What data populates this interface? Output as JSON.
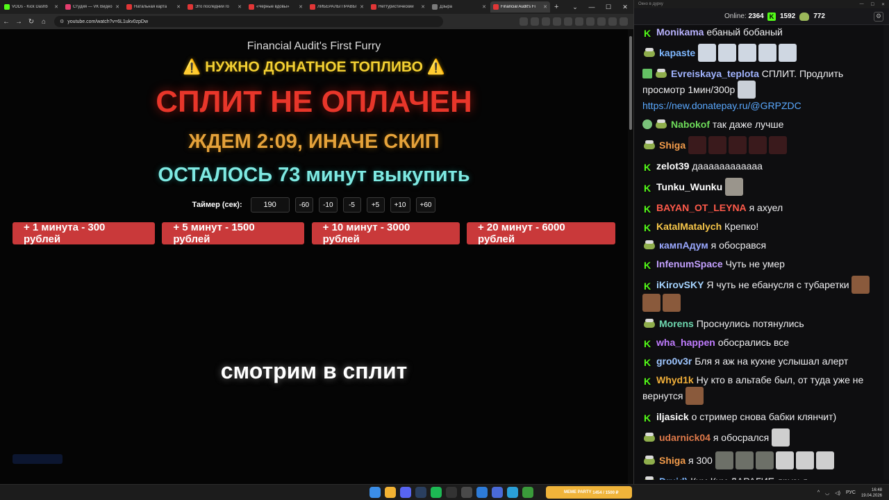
{
  "browser": {
    "tabs": [
      {
        "label": "VODs - Kick Dashb",
        "color": "#53fc18",
        "active": false
      },
      {
        "label": "Студия — VK Видео",
        "color": "#e33d6e",
        "active": false
      },
      {
        "label": "Натальная карта",
        "color": "#e03636",
        "active": false
      },
      {
        "label": "Это последний го",
        "color": "#e03636",
        "active": false
      },
      {
        "label": "«Черные вдовы»",
        "color": "#e03636",
        "active": false
      },
      {
        "label": "ЛИБЕРАЛЫ ПРАВЫ",
        "color": "#e03636",
        "active": false
      },
      {
        "label": "Неттуристический",
        "color": "#e03636",
        "active": false
      },
      {
        "label": "Дзыра",
        "color": "#7a7a7a",
        "active": false
      },
      {
        "label": "Financial Audit's Fi",
        "color": "#e03636",
        "active": true
      }
    ],
    "url": "youtube.com/watch?v=6L1ukv0zpDw"
  },
  "video": {
    "title": "Financial Audit's First Furry",
    "fuel_text": "НУЖНО ДОНАТНОЕ ТОПЛИВО",
    "warn_icon": "⚠️",
    "unpaid_text": "СПЛИТ НЕ ОПЛАЧЕН",
    "wait_text": "ЖДЕМ 2:09, ИНАЧЕ СКИП",
    "remain_text": "ОСТАЛОСЬ 73 минут выкупить",
    "timer_label": "Таймер (сек):",
    "timer_value": "190",
    "timer_buttons": [
      "-60",
      "-10",
      "-5",
      "+5",
      "+10",
      "+60"
    ],
    "donate_buttons": [
      "+ 1 минута - 300 рублей",
      "+ 5 минут - 1500 рублей",
      "+ 10 минут - 3000 рублей",
      "+ 20 минут - 6000 рублей"
    ],
    "split_caption": "смотрим в сплит"
  },
  "chat": {
    "window_title": "Окно в дурку",
    "online_label": "Online:",
    "online_count": "2364",
    "count_a": "1592",
    "count_b": "772",
    "messages": [
      {
        "badge": "k",
        "user": "Monikama",
        "color": "#b9b3ff",
        "text": "ебаный бобаный",
        "emotes": []
      },
      {
        "badge": "pepe",
        "user": "kapaste",
        "color": "#7fb8ff",
        "text": "",
        "emotes": [
          "pale",
          "pale",
          "pale",
          "pale",
          "pale"
        ]
      },
      {
        "badge": "greenpepe",
        "user": "Evreiskaya_teplota",
        "color": "#a1b4ff",
        "text": "СПЛИТ. Продлить просмотр 1мин/300р",
        "link": "https://new.donatepay.ru/@GRPZDC",
        "emotes": [
          "glass"
        ]
      },
      {
        "badge": "okpepe",
        "user": "Nabokof",
        "color": "#6edc5a",
        "text": "так даже лучше",
        "emotes": []
      },
      {
        "badge": "pepe",
        "user": "Shiga",
        "color": "#f29b4a",
        "text": "",
        "emotes": [
          "dark",
          "dark",
          "dark",
          "dark",
          "dark"
        ]
      },
      {
        "badge": "k",
        "user": "zelot39",
        "color": "#ffffff",
        "text": "даааааааааааа",
        "emotes": []
      },
      {
        "badge": "k",
        "user": "Tunku_Wunku",
        "color": "#ffffff",
        "text": "",
        "emotes": [
          "mouse"
        ]
      },
      {
        "badge": "k",
        "user": "BAYAN_OT_LEYNA",
        "color": "#ff5a4a",
        "text": "я ахуел",
        "emotes": []
      },
      {
        "badge": "k",
        "user": "KatalMatalych",
        "color": "#f6c64a",
        "text": "Крепко!",
        "emotes": []
      },
      {
        "badge": "pepe",
        "user": "кампАдум",
        "color": "#9aa8ff",
        "text": "я обосрався",
        "emotes": []
      },
      {
        "badge": "k",
        "user": "InfenumSpace",
        "color": "#c4a1ff",
        "text": "Чуть не умер",
        "emotes": []
      },
      {
        "badge": "k",
        "user": "iKirovSKY",
        "color": "#a6d4ff",
        "text": "Я чуть не ебанусля с тубаретки",
        "emotes": [
          "face",
          "face",
          "face"
        ]
      },
      {
        "badge": "pepe",
        "user": "Morens",
        "color": "#6ed8b0",
        "text": "Проснулись потянулись",
        "emotes": []
      },
      {
        "badge": "k",
        "user": "wha_happen",
        "color": "#c07cff",
        "text": "обосрались все",
        "emotes": []
      },
      {
        "badge": "k",
        "user": "gro0v3r",
        "color": "#9ec6ff",
        "text": "Бля я аж на кухне услышал алерт",
        "emotes": []
      },
      {
        "badge": "k",
        "user": "Whyd1k",
        "color": "#f2b03a",
        "text": "Ну кто в альтабе был, от туда уже не вернутся",
        "emotes": [
          "face"
        ]
      },
      {
        "badge": "k",
        "user": "iljasick",
        "color": "#ffffff",
        "text": "о стример снова бабки клянчит)",
        "emotes": []
      },
      {
        "badge": "pepe",
        "user": "udarnick04",
        "color": "#e07a4a",
        "text": "я обосрался",
        "emotes": [
          "white"
        ]
      },
      {
        "badge": "pepe",
        "user": "Shiga",
        "color": "#f29b4a",
        "text": "я 300",
        "emotes": [
          "grey",
          "grey",
          "grey",
          "white",
          "white",
          "white"
        ]
      },
      {
        "badge": "pepe",
        "user": "Druid)",
        "color": "#7fb8ff",
        "text": "Кхм Кхм ДАРАГИЕ друзья",
        "emotes": []
      }
    ]
  },
  "taskbar": {
    "widget_title": "MEME PARTY",
    "widget_progress": "1454 / 1500 ₽",
    "lang": "РУС",
    "time": "16:48",
    "date": "19.04.2026"
  }
}
